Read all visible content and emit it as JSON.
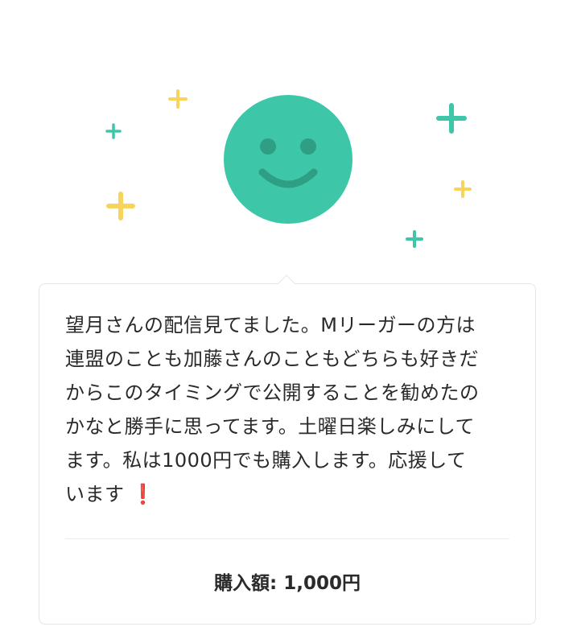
{
  "illustration": {
    "face_color": "#3ec6a8",
    "feature_color": "#2e9e84",
    "sparkle_teal": "#3ec6a8",
    "sparkle_yellow": "#f9d45c",
    "icons": [
      "smiley-face-icon",
      "sparkle-icon"
    ]
  },
  "comment": {
    "lines": [
      "望月さんの配信見てました。Mリーガーの方は",
      "連盟のことも加藤さんのこともどちらも好きだ",
      "からこのタイミングで公開することを勧めたの",
      "かなと勝手に思ってます。土曜日楽しみにして",
      "ます。私は1000円でも購入します。応援して",
      "います"
    ],
    "emoji": "❗",
    "emoji_color": "#d0202e"
  },
  "purchase": {
    "label": "購入額: 1,000円"
  }
}
